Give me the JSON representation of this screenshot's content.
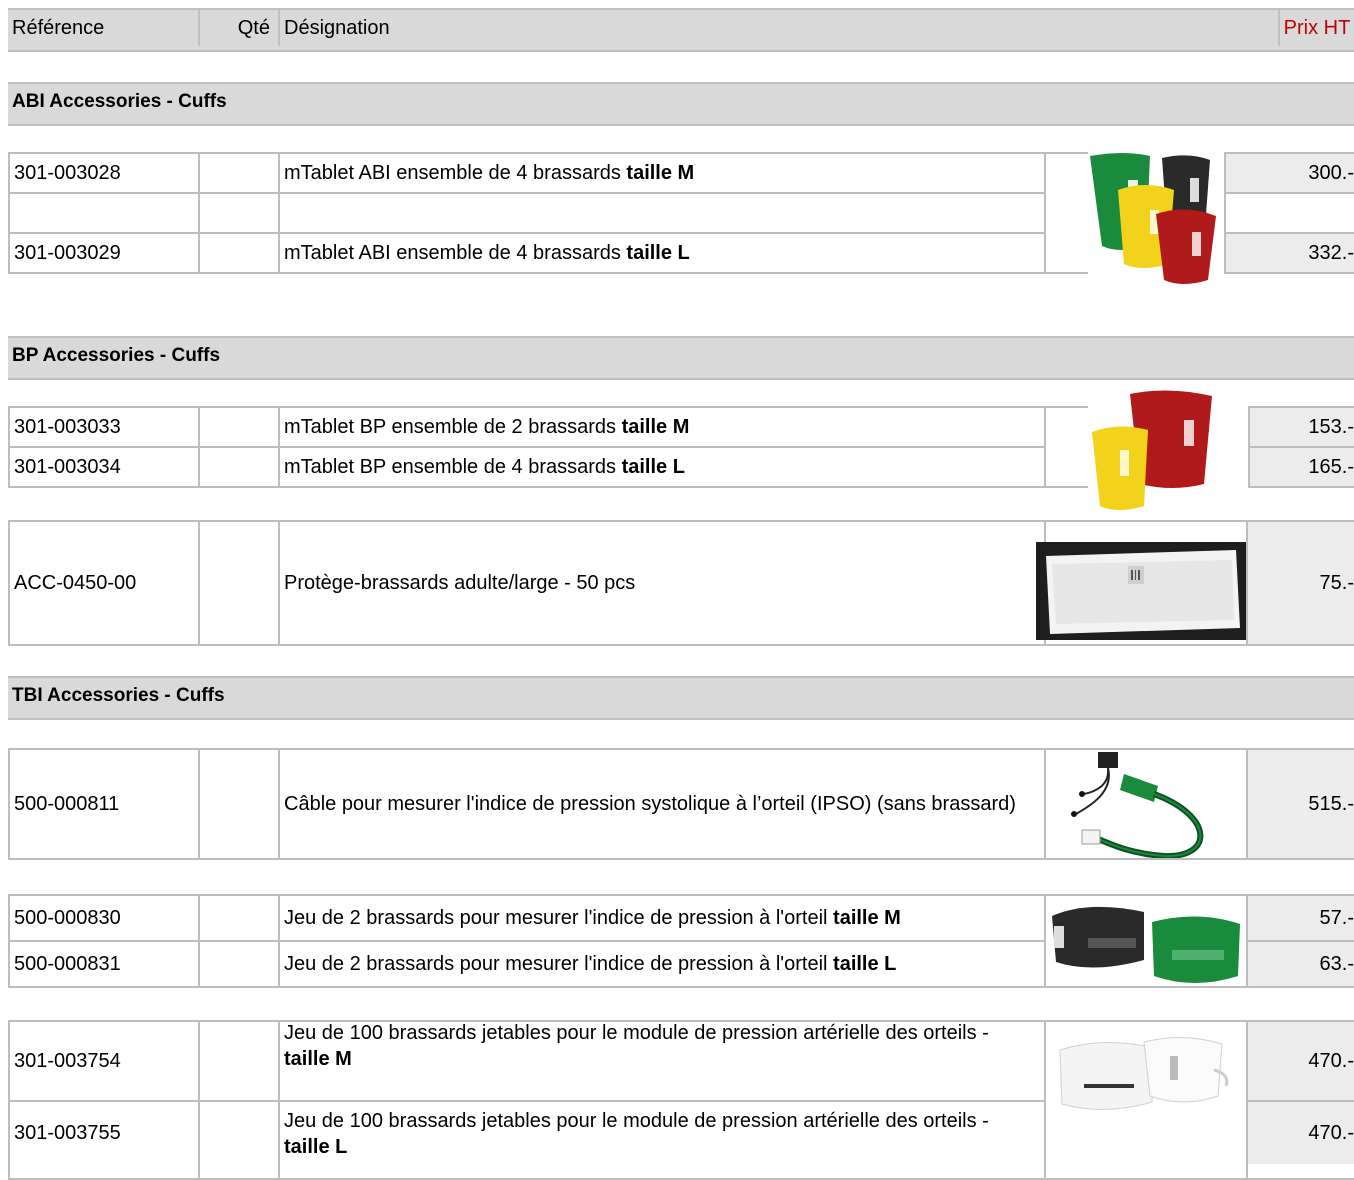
{
  "header": {
    "reference": "Référence",
    "qty": "Qté",
    "designation": "Désignation",
    "price": "Prix HT",
    "price_color": "#c00000"
  },
  "sections": [
    {
      "title": "ABI Accessories - Cuffs",
      "items": [
        {
          "ref": "301-003028",
          "desc": "mTablet ABI ensemble de 4 brassards ",
          "desc_bold": "taille M",
          "price": "300.-"
        },
        {
          "ref": "301-003029",
          "desc": "mTablet ABI ensemble de 4 brassards ",
          "desc_bold": "taille L",
          "price": "332.-"
        }
      ]
    },
    {
      "title": "BP Accessories - Cuffs",
      "items": [
        {
          "ref": "301-003033",
          "desc": "mTablet BP ensemble de 2 brassards ",
          "desc_bold": "taille M",
          "price": "153.-"
        },
        {
          "ref": "301-003034",
          "desc": "mTablet BP ensemble de 4 brassards ",
          "desc_bold": "taille L",
          "price": "165.-"
        },
        {
          "ref": "ACC-0450-00",
          "desc": "Protège-brassards adulte/large - 50 pcs",
          "desc_bold": "",
          "price": "75.-"
        }
      ]
    },
    {
      "title": "TBI Accessories - Cuffs",
      "items": [
        {
          "ref": "500-000811",
          "desc": "Câble pour mesurer l'indice de pression systolique à l’orteil (IPSO) (sans brassard)",
          "desc_bold": "",
          "price": "515.-"
        },
        {
          "ref": "500-000830",
          "desc": "Jeu de 2 brassards pour mesurer l'indice de pression à l'orteil ",
          "desc_bold": "taille M",
          "price": "57.-"
        },
        {
          "ref": "500-000831",
          "desc": "Jeu de 2 brassards pour mesurer l'indice de pression à l'orteil ",
          "desc_bold": "taille L",
          "price": "63.-"
        },
        {
          "ref": "301-003754",
          "desc": "Jeu de 100 brassards jetables pour le module de pression artérielle des orteils - ",
          "desc_bold": "taille M",
          "price": "470.-"
        },
        {
          "ref": "301-003755",
          "desc": "Jeu de 100 brassards jetables pour le module de pression artérielle des orteils - ",
          "desc_bold": "taille L",
          "price": "470.-"
        }
      ]
    }
  ],
  "colors": {
    "bar_bg": "#d9d9d9",
    "price_bg": "#ececec",
    "grid": "#bdbdbd",
    "cuff_green": "#1a8a3c",
    "cuff_black": "#2a2a2a",
    "cuff_yellow": "#f2d21a",
    "cuff_red": "#b11a1a"
  }
}
